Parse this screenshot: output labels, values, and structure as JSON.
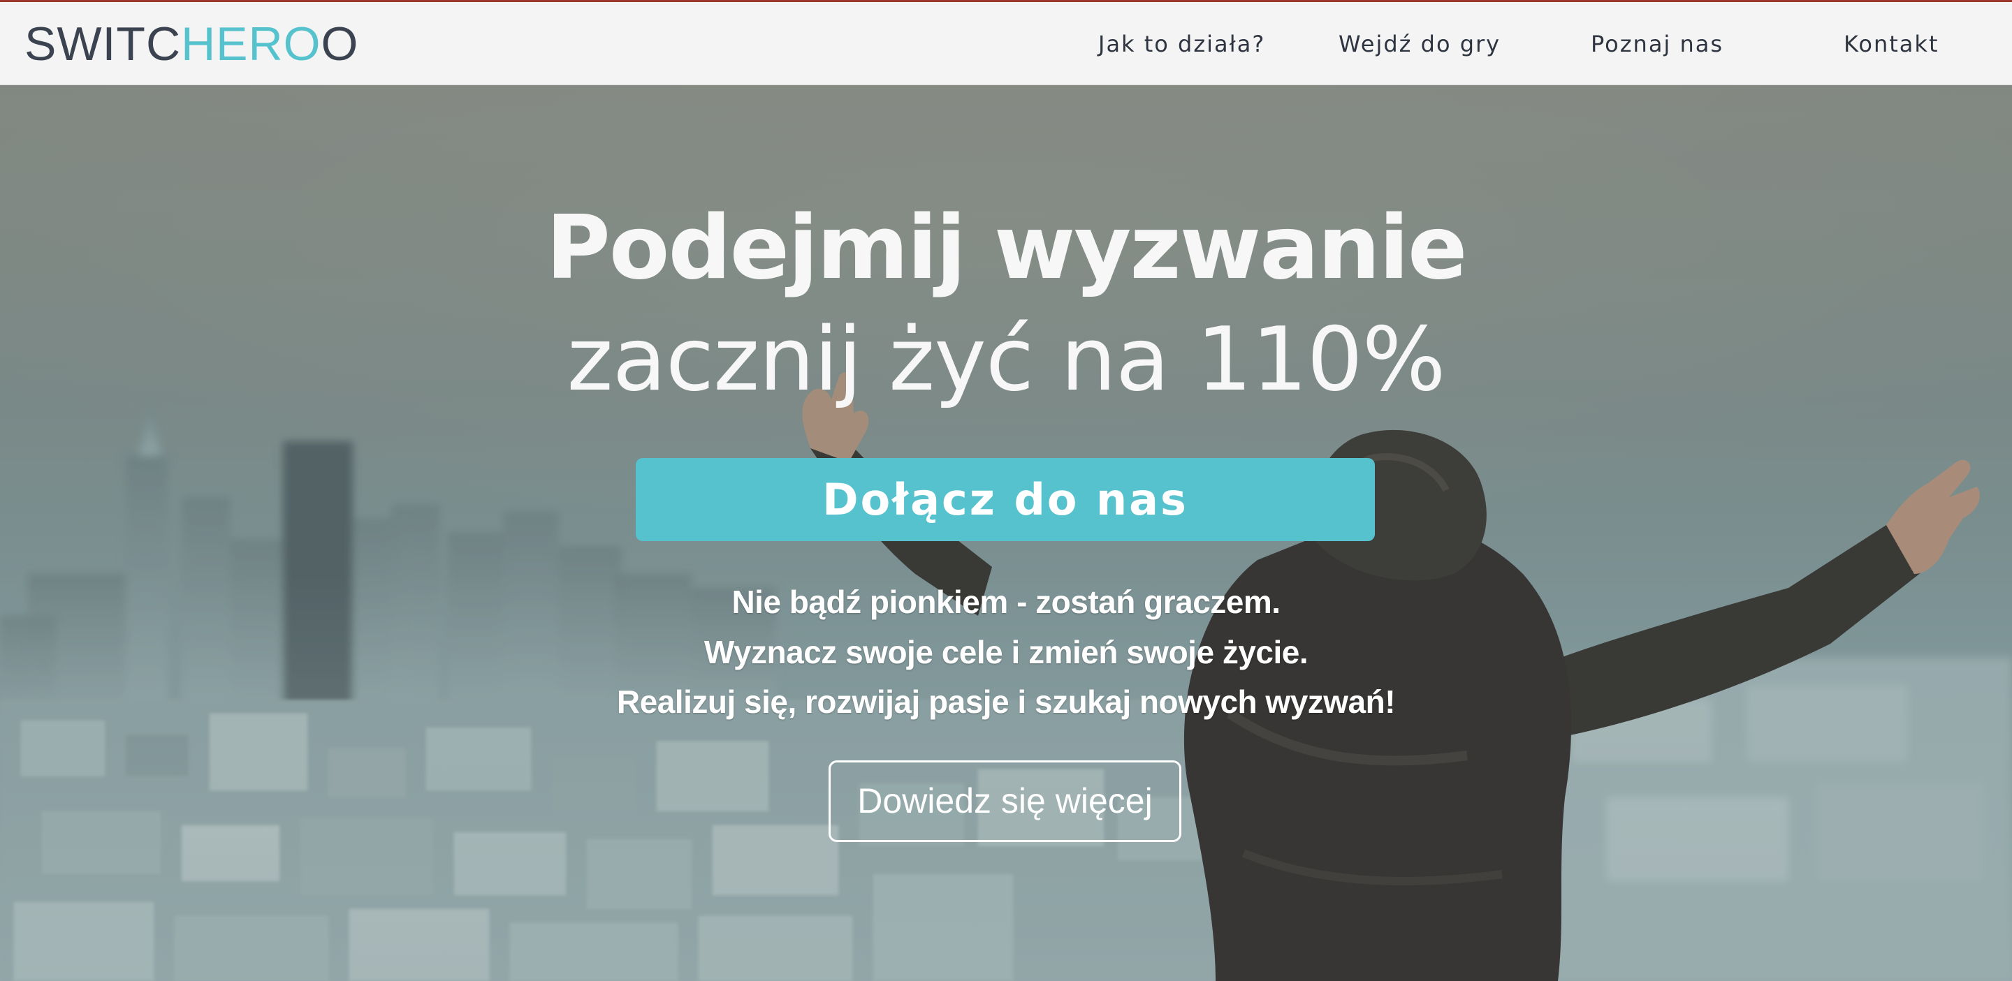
{
  "brand": {
    "logo_part_1": "SWITC",
    "logo_part_2": "HERO",
    "logo_part_3": "O",
    "color_dark": "#3b4350",
    "color_teal": "#56c2cd"
  },
  "nav": {
    "items": [
      {
        "label": "Jak to działa?"
      },
      {
        "label": "Wejdź do gry"
      },
      {
        "label": "Poznaj nas"
      },
      {
        "label": "Kontakt"
      }
    ]
  },
  "hero": {
    "headline_line_1": "Podejmij wyzwanie",
    "headline_line_2": "zacznij żyć na 110%",
    "primary_cta_label": "Dołącz do nas",
    "tagline_lines": [
      "Nie bądź pionkiem - zostań graczem.",
      "Wyznacz swoje cele i zmień swoje życie.",
      "Realizuj się, rozwijaj pasje i szukaj nowych wyzwań!"
    ],
    "secondary_cta_label": "Dowiedz się więcej",
    "accent_color": "#56c2cd",
    "background_image": "hazy-city-skyline-person-in-hoodie-arms-raised"
  }
}
